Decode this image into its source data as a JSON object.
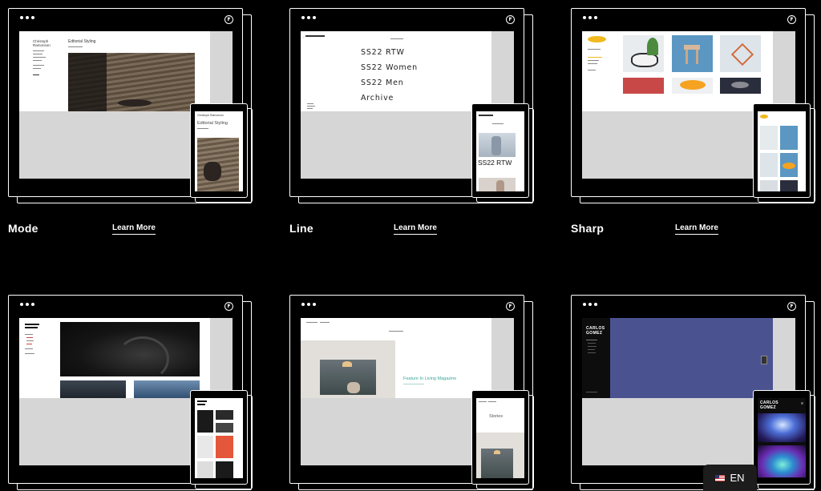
{
  "cards": [
    {
      "title": "Mode",
      "link": "Learn More",
      "preview_heading": "Editorial Styling",
      "brand": "Christoph Ramonson",
      "phone_heading": "Editorial Styling"
    },
    {
      "title": "Line",
      "link": "Learn More",
      "menu": [
        "SS22 RTW",
        "SS22 Women",
        "SS22 Men",
        "Archive"
      ],
      "phone_caption": "SS22 RTW"
    },
    {
      "title": "Sharp",
      "link": "Learn More"
    },
    {
      "title": "",
      "link": ""
    },
    {
      "title": "",
      "link": "",
      "feature": "Feature In Living Magazine",
      "phone_caption": "Stories"
    },
    {
      "title": "",
      "link": "",
      "brand": "CARLOS GOMEZ"
    }
  ],
  "language": {
    "label": "EN"
  },
  "colors": {
    "background": "#000000",
    "stage": "#d6d6d6",
    "feature_teal": "#3aa89a",
    "blue_panel": "#4a5390",
    "sharp_yellow": "#f2b91e"
  }
}
